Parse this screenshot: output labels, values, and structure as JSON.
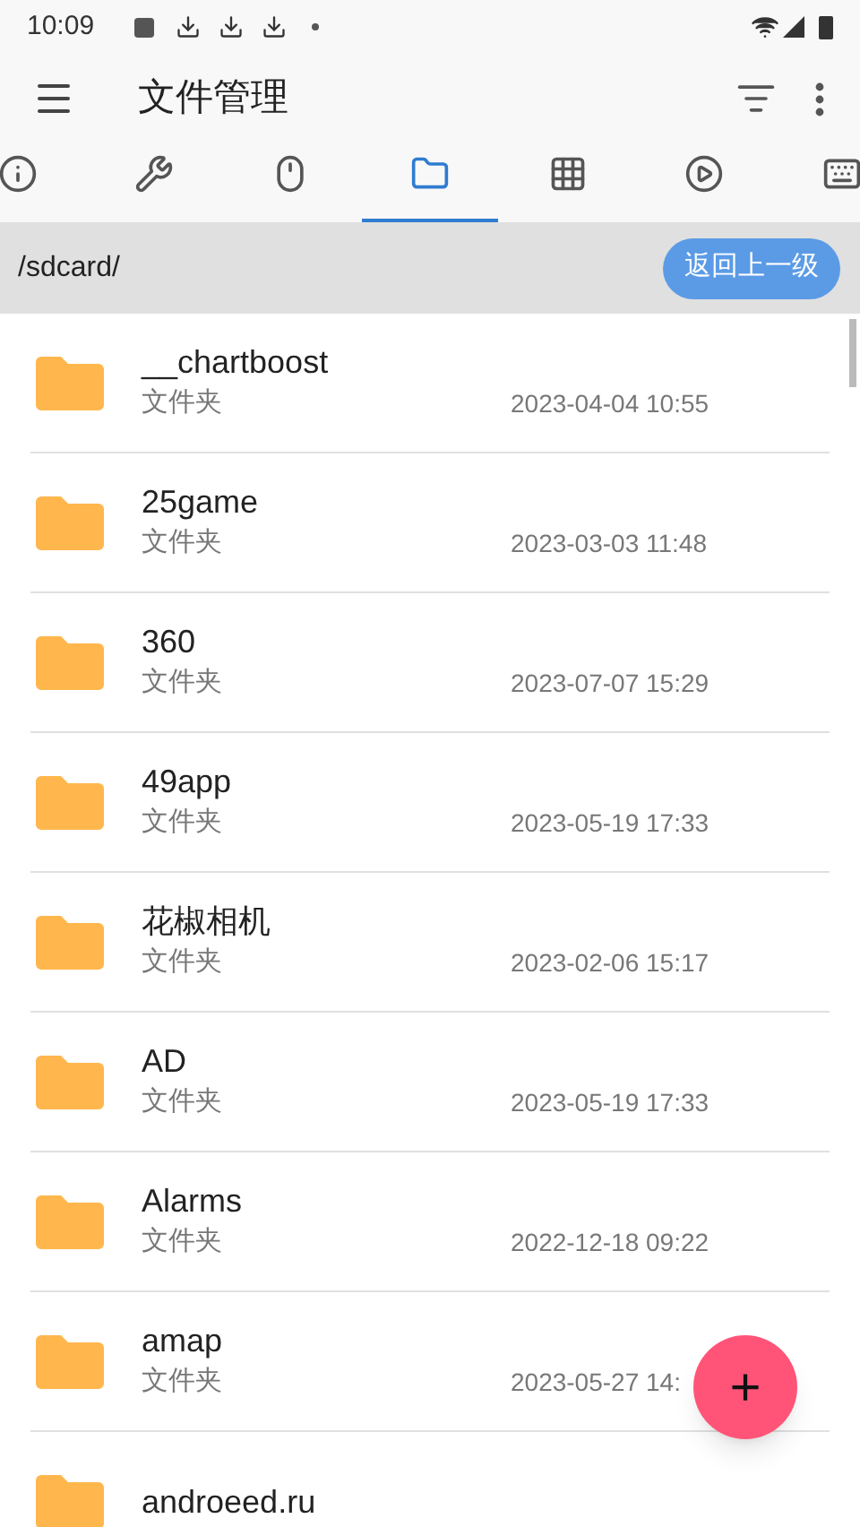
{
  "status_bar": {
    "time": "10:09"
  },
  "toolbar": {
    "title": "文件管理"
  },
  "tabs": [
    {
      "kind": "info",
      "selected": false
    },
    {
      "kind": "wrench",
      "selected": false
    },
    {
      "kind": "mouse",
      "selected": false
    },
    {
      "kind": "folder",
      "selected": true
    },
    {
      "kind": "grid",
      "selected": false
    },
    {
      "kind": "play",
      "selected": false
    },
    {
      "kind": "keyboard",
      "selected": false
    }
  ],
  "path_bar": {
    "path": "/sdcard/",
    "button": "返回上一级"
  },
  "files": [
    {
      "name": "__chartboost",
      "type": "文件夹",
      "date": "2023-04-04 10:55"
    },
    {
      "name": "25game",
      "type": "文件夹",
      "date": "2023-03-03 11:48"
    },
    {
      "name": "360",
      "type": "文件夹",
      "date": "2023-07-07 15:29"
    },
    {
      "name": "49app",
      "type": "文件夹",
      "date": "2023-05-19 17:33"
    },
    {
      "name": "花椒相机",
      "type": "文件夹",
      "date": "2023-02-06 15:17"
    },
    {
      "name": "AD",
      "type": "文件夹",
      "date": "2023-05-19 17:33"
    },
    {
      "name": "Alarms",
      "type": "文件夹",
      "date": "2022-12-18 09:22"
    },
    {
      "name": "amap",
      "type": "文件夹",
      "date": "2023-05-27 14:"
    },
    {
      "name": "androeed.ru"
    }
  ],
  "fab": {
    "label": "+"
  }
}
